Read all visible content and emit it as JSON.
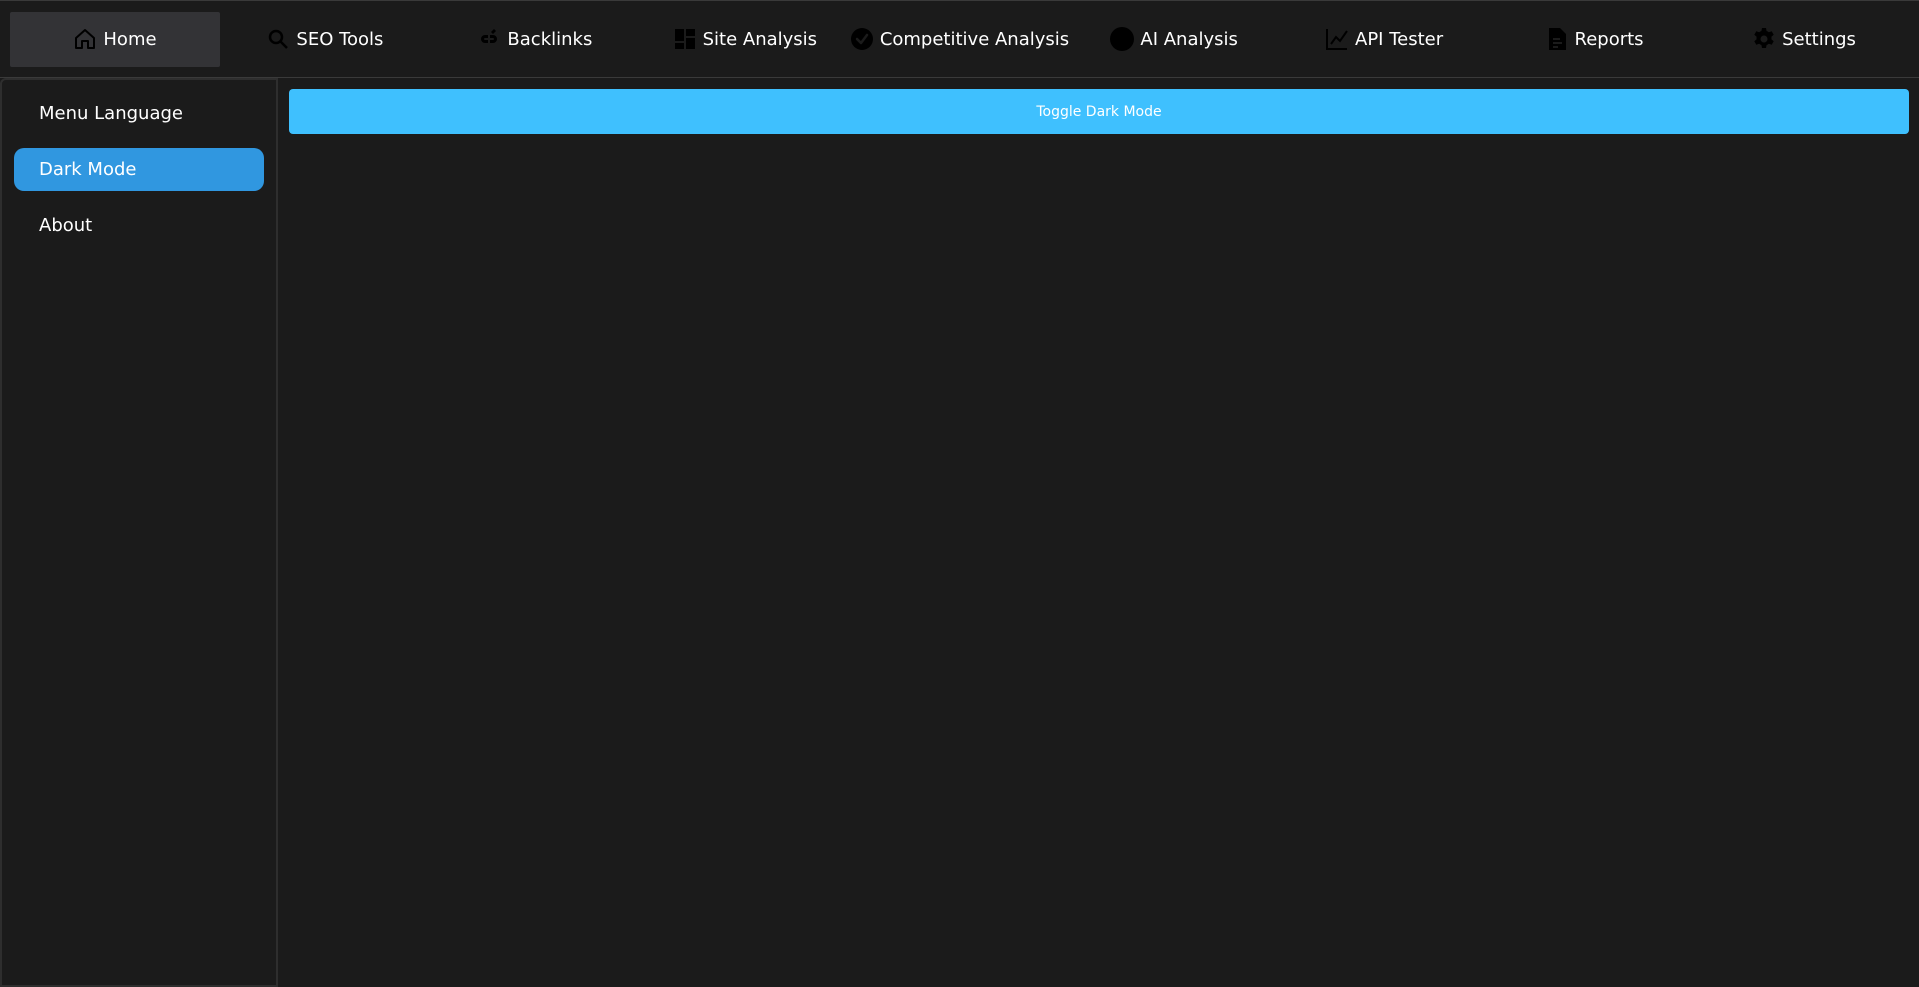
{
  "nav": {
    "items": [
      {
        "label": "Home",
        "icon": "home-icon",
        "active": true
      },
      {
        "label": "SEO Tools",
        "icon": "search-icon",
        "active": false
      },
      {
        "label": "Backlinks",
        "icon": "link-icon",
        "active": false
      },
      {
        "label": "Site Analysis",
        "icon": "dashboard-icon",
        "active": false
      },
      {
        "label": "Competitive Analysis",
        "icon": "check-circle-icon",
        "active": false
      },
      {
        "label": "AI Analysis",
        "icon": "circle-icon",
        "active": false
      },
      {
        "label": "API Tester",
        "icon": "chart-line-icon",
        "active": false
      },
      {
        "label": "Reports",
        "icon": "document-icon",
        "active": false
      },
      {
        "label": "Settings",
        "icon": "gear-icon",
        "active": false
      }
    ]
  },
  "sidebar": {
    "items": [
      {
        "label": "Menu Language",
        "active": false
      },
      {
        "label": "Dark Mode",
        "active": true
      },
      {
        "label": "About",
        "active": false
      }
    ]
  },
  "main": {
    "toggle_label": "Toggle Dark Mode"
  },
  "colors": {
    "background": "#1b1b1b",
    "nav_active": "#333336",
    "sidebar_active": "#3097e0",
    "toggle_button": "#3fc0fe"
  }
}
